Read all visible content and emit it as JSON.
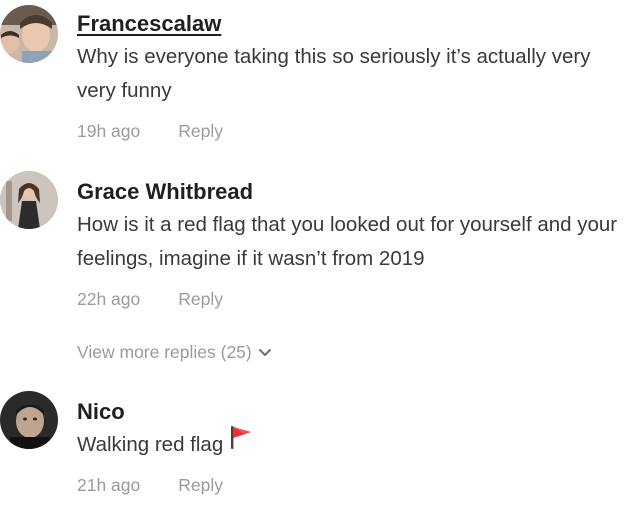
{
  "comments": [
    {
      "username": "Francescalaw",
      "text": "Why is everyone taking this so seriously it’s actually very very funny",
      "time": "19h ago",
      "reply_label": "Reply"
    },
    {
      "username": "Grace Whitbread",
      "text": "How is it a red flag that you looked out for yourself and your feelings, imagine if it wasn’t from 2019",
      "time": "22h ago",
      "reply_label": "Reply",
      "more_replies_label": "View more replies (25)"
    },
    {
      "username": "Nico",
      "text": "Walking red flag",
      "emoji_icon": "red-flag-icon",
      "time": "21h ago",
      "reply_label": "Reply"
    }
  ],
  "colors": {
    "username": "#1f1f21",
    "text": "#3a3a3d",
    "meta": "#9a9aa0",
    "flag": "#e8303a"
  }
}
